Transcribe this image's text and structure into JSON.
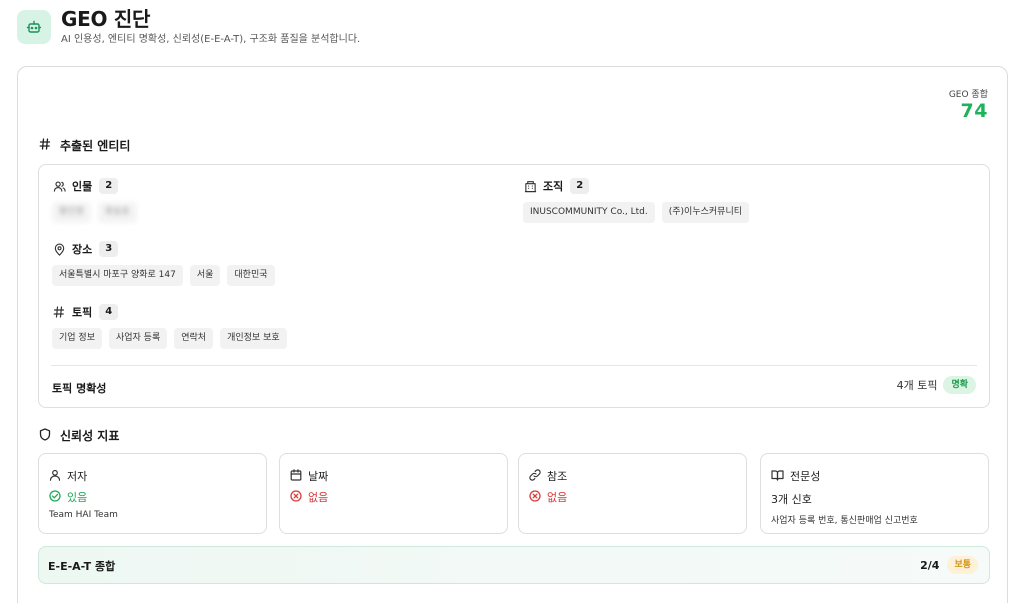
{
  "header": {
    "title": "GEO 진단",
    "subtitle": "AI 인용성, 엔티티 명확성, 신뢰성(E-E-A-T), 구조화 품질을 분석합니다.",
    "icon": "robot-icon"
  },
  "score": {
    "label": "GEO 종합",
    "value": "74",
    "color": "#1eb35b"
  },
  "entities": {
    "title": "추출된 엔티티",
    "people": {
      "label": "인물",
      "count": "2",
      "items": [
        "황인영",
        "류승호"
      ]
    },
    "organizations": {
      "label": "조직",
      "count": "2",
      "items": [
        "INUSCOMMUNITY Co., Ltd.",
        "(주)이누스커뮤니티"
      ]
    },
    "places": {
      "label": "장소",
      "count": "3",
      "items": [
        "서울특별시 마포구 양화로 147",
        "서울",
        "대한민국"
      ]
    },
    "topics": {
      "label": "토픽",
      "count": "4",
      "items": [
        "기업 정보",
        "사업자 등록",
        "연락처",
        "개인정보 보호"
      ]
    },
    "clarity": {
      "label": "토픽 명확성",
      "count_text": "4개 토픽",
      "badge": "명확"
    }
  },
  "trust": {
    "title": "신뢰성 지표",
    "cards": [
      {
        "label": "저자",
        "status": "있음",
        "detail": "Team HAI Team"
      },
      {
        "label": "날짜",
        "status": "없음"
      },
      {
        "label": "참조",
        "status": "없음"
      },
      {
        "label": "전문성",
        "value": "3개 신호",
        "detail": "사업자 등록 번호, 통신판매업 신고번호"
      }
    ]
  },
  "eeat": {
    "label": "E-E-A-T 종합",
    "score": "2/4",
    "badge": "보통"
  },
  "colors": {
    "accent_green": "#1eb35b",
    "error_red": "#d93a3a",
    "warning_amber": "#d4951b"
  }
}
